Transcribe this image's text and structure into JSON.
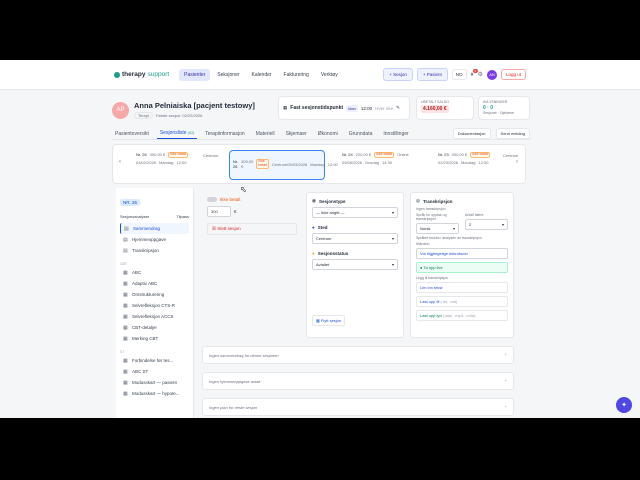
{
  "nav": {
    "logo": "therapy",
    "logo_sub": "support",
    "links": [
      "Pasienter",
      "Seksjoner",
      "Kalender",
      "Fakturering",
      "Verktøy"
    ],
    "active": 0,
    "btn_seksjon": "+ Sesjon",
    "btn_pasient": "+ Pasient",
    "lang": "NO",
    "notif_count": "3",
    "avatar": "AN",
    "logout": "Logg ut"
  },
  "patient": {
    "initials": "AP",
    "name": "Anna Pelniaiska [pacjent testowy]",
    "tag": "Terapi",
    "last_session": "Første sesjon: 02/22/2026"
  },
  "fixed": {
    "title": "Fast sesjonstidspunkt",
    "day": "Man",
    "time": "12:00",
    "duration": "Hver uke"
  },
  "unpaid": {
    "label": "UBETALT SALDO",
    "amount": "4.160,00 €"
  },
  "abs": {
    "label": "AVLYSNINGER",
    "nums": "0 · 0",
    "sub": "Sesjoner · Gjeldene"
  },
  "tabs": {
    "items": [
      "Pasientoversikt",
      "Sesjonsliste",
      "Terapiinformasjon",
      "Materiell",
      "Skjemaer",
      "Økonomi",
      "Grunndata",
      "Innstillinger"
    ],
    "count": "(52)",
    "active": 1,
    "btn_doc": "Dokumentasjon",
    "btn_msg": "Send melding"
  },
  "strip": {
    "cards": [
      {
        "nr": "Nr. 26",
        "price": "300,00 €",
        "badge": "Ikke betalt",
        "date": "03/02/2026",
        "day": "Mandag",
        "time": "12:00",
        "place": "Centrum"
      },
      {
        "nr": "Nr. 26",
        "price": "300,00 €",
        "badge": "Ikke betalt",
        "date": "09/03/2026",
        "day": "Mandag",
        "time": "12:00",
        "place": "Centrum"
      },
      {
        "nr": "Nr. 24",
        "price": "220,00 €",
        "badge": "Ikke betalt",
        "date": "09/06/2026",
        "day": "Onsdag",
        "time": "14:30",
        "place": "Online"
      },
      {
        "nr": "Nr. 23",
        "price": "300,00 €",
        "badge": "Ikke betalt",
        "date": "02/23/2026",
        "day": "Mandag",
        "time": "12:00",
        "place": "Centrum"
      }
    ]
  },
  "left": {
    "nr": "NR. 26",
    "head": "Sesjonsanalyser",
    "head_btn": "Tilpass",
    "items": [
      "Sammendrag",
      "Hjemmeoppgave",
      "Transkripsjon"
    ],
    "sec_cbt": "CBT",
    "cbt": [
      "ABC",
      "Adaptiv ABC",
      "Omstrukturering",
      "Selvrefleksjon CTS-R",
      "Selvrefleksjon ACCS",
      "CBT-detaljer",
      "Merking CBT"
    ],
    "sec_st": "ST",
    "st": [
      "Forbindelse før tes...",
      "ABC ST",
      "Modusskart — pasient",
      "Modusskart — hypote..."
    ]
  },
  "session": {
    "paid_label": "Ikke betalt",
    "price": "300",
    "currency": "€",
    "delete": "Slett sesjon"
  },
  "type": {
    "title": "Sesjonstype",
    "type_val": "— Ikke angitt —",
    "place_title": "Sted",
    "place_val": "Centrum",
    "status_title": "Sesjonsstatus",
    "status_val": "Avtaltet",
    "move": "Flytt sesjon"
  },
  "trans": {
    "title": "Transkripsjon",
    "no_trans": "Ingen transkripsjon",
    "split": "Språk for opptak og transkripsjon",
    "speakers": "Antall talere",
    "lang": "Norsk",
    "num": "2",
    "hint": "Språket brukes i analysen av transkripsjon",
    "mic": "Mikrofon",
    "mic_val": "Via tilgjengelige mikrofoner",
    "start": "Ta opp live",
    "add": "Legg til transkripsjon",
    "insert": "Lim inn tekst",
    "upload_file": "Last opp fil",
    "upload_file_ext": "(.txt, .md)",
    "upload_audio": "Last opp lyd",
    "upload_audio_ext": "(.wav, .mp3, .m4a)"
  },
  "accordions": [
    "Ingen sammendrag for denne sesjonen",
    "Ingen hjemmeoppgave avtalt",
    "Ingen plan for neste sesjon"
  ]
}
